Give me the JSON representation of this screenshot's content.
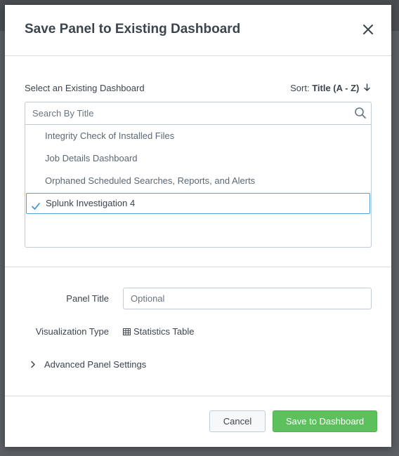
{
  "modal": {
    "title": "Save Panel to Existing Dashboard",
    "close_icon": "close-icon"
  },
  "dashboard_select": {
    "label": "Select an Existing Dashboard",
    "sort_label": "Sort:",
    "sort_value": "Title (A - Z)",
    "sort_icon": "arrow-down-icon",
    "search_placeholder": "Search By Title",
    "search_icon": "search-icon",
    "items": [
      {
        "label": "Integrity Check of Installed Files",
        "selected": false
      },
      {
        "label": "Job Details Dashboard",
        "selected": false
      },
      {
        "label": "Orphaned Scheduled Searches, Reports, and Alerts",
        "selected": false
      },
      {
        "label": "Splunk Investigation 4",
        "selected": true
      }
    ]
  },
  "form": {
    "panel_title_label": "Panel Title",
    "panel_title_placeholder": "Optional",
    "panel_title_value": "",
    "viz_type_label": "Visualization Type",
    "viz_type_icon": "table-icon",
    "viz_type_value": "Statistics Table",
    "advanced_label": "Advanced Panel Settings",
    "advanced_icon": "chevron-right-icon"
  },
  "footer": {
    "cancel_label": "Cancel",
    "save_label": "Save to Dashboard"
  },
  "colors": {
    "primary": "#5cc05c",
    "selection_border": "#4fa1dc",
    "text": "#3c444d"
  }
}
